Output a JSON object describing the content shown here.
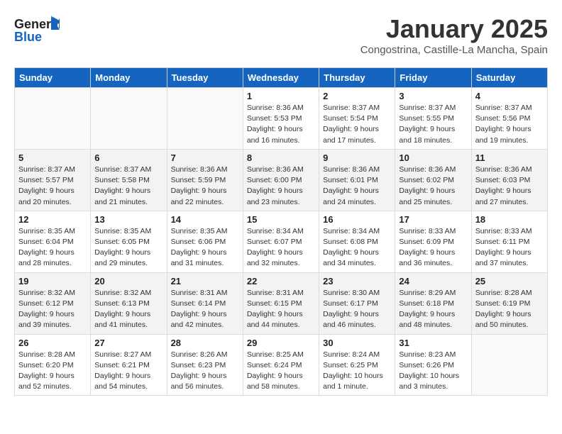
{
  "header": {
    "logo_general": "General",
    "logo_blue": "Blue",
    "month_title": "January 2025",
    "location": "Congostrina, Castille-La Mancha, Spain"
  },
  "weekdays": [
    "Sunday",
    "Monday",
    "Tuesday",
    "Wednesday",
    "Thursday",
    "Friday",
    "Saturday"
  ],
  "weeks": [
    [
      {
        "day": "",
        "sunrise": "",
        "sunset": "",
        "daylight": ""
      },
      {
        "day": "",
        "sunrise": "",
        "sunset": "",
        "daylight": ""
      },
      {
        "day": "",
        "sunrise": "",
        "sunset": "",
        "daylight": ""
      },
      {
        "day": "1",
        "sunrise": "Sunrise: 8:36 AM",
        "sunset": "Sunset: 5:53 PM",
        "daylight": "Daylight: 9 hours and 16 minutes."
      },
      {
        "day": "2",
        "sunrise": "Sunrise: 8:37 AM",
        "sunset": "Sunset: 5:54 PM",
        "daylight": "Daylight: 9 hours and 17 minutes."
      },
      {
        "day": "3",
        "sunrise": "Sunrise: 8:37 AM",
        "sunset": "Sunset: 5:55 PM",
        "daylight": "Daylight: 9 hours and 18 minutes."
      },
      {
        "day": "4",
        "sunrise": "Sunrise: 8:37 AM",
        "sunset": "Sunset: 5:56 PM",
        "daylight": "Daylight: 9 hours and 19 minutes."
      }
    ],
    [
      {
        "day": "5",
        "sunrise": "Sunrise: 8:37 AM",
        "sunset": "Sunset: 5:57 PM",
        "daylight": "Daylight: 9 hours and 20 minutes."
      },
      {
        "day": "6",
        "sunrise": "Sunrise: 8:37 AM",
        "sunset": "Sunset: 5:58 PM",
        "daylight": "Daylight: 9 hours and 21 minutes."
      },
      {
        "day": "7",
        "sunrise": "Sunrise: 8:36 AM",
        "sunset": "Sunset: 5:59 PM",
        "daylight": "Daylight: 9 hours and 22 minutes."
      },
      {
        "day": "8",
        "sunrise": "Sunrise: 8:36 AM",
        "sunset": "Sunset: 6:00 PM",
        "daylight": "Daylight: 9 hours and 23 minutes."
      },
      {
        "day": "9",
        "sunrise": "Sunrise: 8:36 AM",
        "sunset": "Sunset: 6:01 PM",
        "daylight": "Daylight: 9 hours and 24 minutes."
      },
      {
        "day": "10",
        "sunrise": "Sunrise: 8:36 AM",
        "sunset": "Sunset: 6:02 PM",
        "daylight": "Daylight: 9 hours and 25 minutes."
      },
      {
        "day": "11",
        "sunrise": "Sunrise: 8:36 AM",
        "sunset": "Sunset: 6:03 PM",
        "daylight": "Daylight: 9 hours and 27 minutes."
      }
    ],
    [
      {
        "day": "12",
        "sunrise": "Sunrise: 8:35 AM",
        "sunset": "Sunset: 6:04 PM",
        "daylight": "Daylight: 9 hours and 28 minutes."
      },
      {
        "day": "13",
        "sunrise": "Sunrise: 8:35 AM",
        "sunset": "Sunset: 6:05 PM",
        "daylight": "Daylight: 9 hours and 29 minutes."
      },
      {
        "day": "14",
        "sunrise": "Sunrise: 8:35 AM",
        "sunset": "Sunset: 6:06 PM",
        "daylight": "Daylight: 9 hours and 31 minutes."
      },
      {
        "day": "15",
        "sunrise": "Sunrise: 8:34 AM",
        "sunset": "Sunset: 6:07 PM",
        "daylight": "Daylight: 9 hours and 32 minutes."
      },
      {
        "day": "16",
        "sunrise": "Sunrise: 8:34 AM",
        "sunset": "Sunset: 6:08 PM",
        "daylight": "Daylight: 9 hours and 34 minutes."
      },
      {
        "day": "17",
        "sunrise": "Sunrise: 8:33 AM",
        "sunset": "Sunset: 6:09 PM",
        "daylight": "Daylight: 9 hours and 36 minutes."
      },
      {
        "day": "18",
        "sunrise": "Sunrise: 8:33 AM",
        "sunset": "Sunset: 6:11 PM",
        "daylight": "Daylight: 9 hours and 37 minutes."
      }
    ],
    [
      {
        "day": "19",
        "sunrise": "Sunrise: 8:32 AM",
        "sunset": "Sunset: 6:12 PM",
        "daylight": "Daylight: 9 hours and 39 minutes."
      },
      {
        "day": "20",
        "sunrise": "Sunrise: 8:32 AM",
        "sunset": "Sunset: 6:13 PM",
        "daylight": "Daylight: 9 hours and 41 minutes."
      },
      {
        "day": "21",
        "sunrise": "Sunrise: 8:31 AM",
        "sunset": "Sunset: 6:14 PM",
        "daylight": "Daylight: 9 hours and 42 minutes."
      },
      {
        "day": "22",
        "sunrise": "Sunrise: 8:31 AM",
        "sunset": "Sunset: 6:15 PM",
        "daylight": "Daylight: 9 hours and 44 minutes."
      },
      {
        "day": "23",
        "sunrise": "Sunrise: 8:30 AM",
        "sunset": "Sunset: 6:17 PM",
        "daylight": "Daylight: 9 hours and 46 minutes."
      },
      {
        "day": "24",
        "sunrise": "Sunrise: 8:29 AM",
        "sunset": "Sunset: 6:18 PM",
        "daylight": "Daylight: 9 hours and 48 minutes."
      },
      {
        "day": "25",
        "sunrise": "Sunrise: 8:28 AM",
        "sunset": "Sunset: 6:19 PM",
        "daylight": "Daylight: 9 hours and 50 minutes."
      }
    ],
    [
      {
        "day": "26",
        "sunrise": "Sunrise: 8:28 AM",
        "sunset": "Sunset: 6:20 PM",
        "daylight": "Daylight: 9 hours and 52 minutes."
      },
      {
        "day": "27",
        "sunrise": "Sunrise: 8:27 AM",
        "sunset": "Sunset: 6:21 PM",
        "daylight": "Daylight: 9 hours and 54 minutes."
      },
      {
        "day": "28",
        "sunrise": "Sunrise: 8:26 AM",
        "sunset": "Sunset: 6:23 PM",
        "daylight": "Daylight: 9 hours and 56 minutes."
      },
      {
        "day": "29",
        "sunrise": "Sunrise: 8:25 AM",
        "sunset": "Sunset: 6:24 PM",
        "daylight": "Daylight: 9 hours and 58 minutes."
      },
      {
        "day": "30",
        "sunrise": "Sunrise: 8:24 AM",
        "sunset": "Sunset: 6:25 PM",
        "daylight": "Daylight: 10 hours and 1 minute."
      },
      {
        "day": "31",
        "sunrise": "Sunrise: 8:23 AM",
        "sunset": "Sunset: 6:26 PM",
        "daylight": "Daylight: 10 hours and 3 minutes."
      },
      {
        "day": "",
        "sunrise": "",
        "sunset": "",
        "daylight": ""
      }
    ]
  ]
}
